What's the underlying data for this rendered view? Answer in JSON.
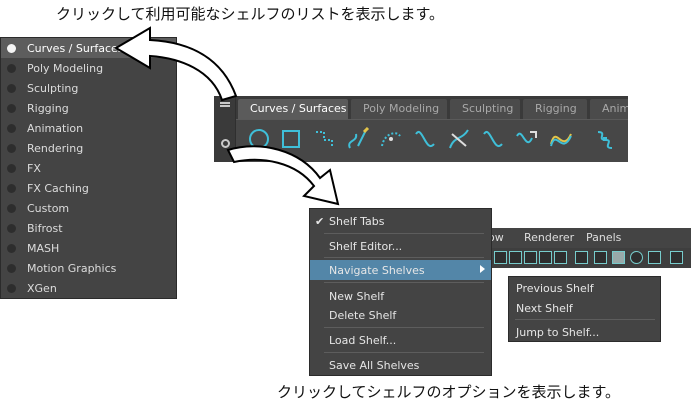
{
  "captions": {
    "top": "クリックして利用可能なシェルフのリストを表示します。",
    "bottom": "クリックしてシェルフのオプションを表示します。"
  },
  "shelf_list": {
    "selected": "Curves / Surfaces",
    "items": [
      "Curves / Surfaces",
      "Poly Modeling",
      "Sculpting",
      "Rigging",
      "Animation",
      "Rendering",
      "FX",
      "FX Caching",
      "Custom",
      "Bifrost",
      "MASH",
      "Motion Graphics",
      "XGen"
    ]
  },
  "shelf_tabs": {
    "active": "Curves / Surfaces",
    "tabs": [
      "Curves / Surfaces",
      "Poly Modeling",
      "Sculpting",
      "Rigging",
      "Anima"
    ]
  },
  "shelf_tools": {
    "icons": [
      "nurbs-circle-icon",
      "nurbs-square-icon",
      "cv-curve-icon",
      "ep-curve-icon",
      "pencil-curve-icon",
      "three-point-arc-icon",
      "bezier-curve-icon",
      "curve-tool-icon",
      "attach-curves-icon",
      "detach-curves-icon",
      "rebuild-curve-icon",
      "revolve-icon"
    ],
    "accent": "#3fbfd8",
    "highlight": "#e3c449"
  },
  "menu_bar": {
    "items": [
      "ow",
      "Renderer",
      "Panels"
    ]
  },
  "options_menu": {
    "items": [
      {
        "label": "Shelf Tabs",
        "checked": true
      },
      {
        "label": "Shelf Editor..."
      },
      {
        "label": "Navigate Shelves",
        "submenu": true,
        "highlighted": true
      },
      {
        "label": "New Shelf"
      },
      {
        "label": "Delete Shelf"
      },
      {
        "label": "Load Shelf..."
      },
      {
        "label": "Save All Shelves"
      }
    ],
    "check_glyph": "✔",
    "highlight_color": "#5386a8"
  },
  "submenu": {
    "items": [
      "Previous Shelf",
      "Next Shelf",
      "Jump to Shelf..."
    ]
  }
}
